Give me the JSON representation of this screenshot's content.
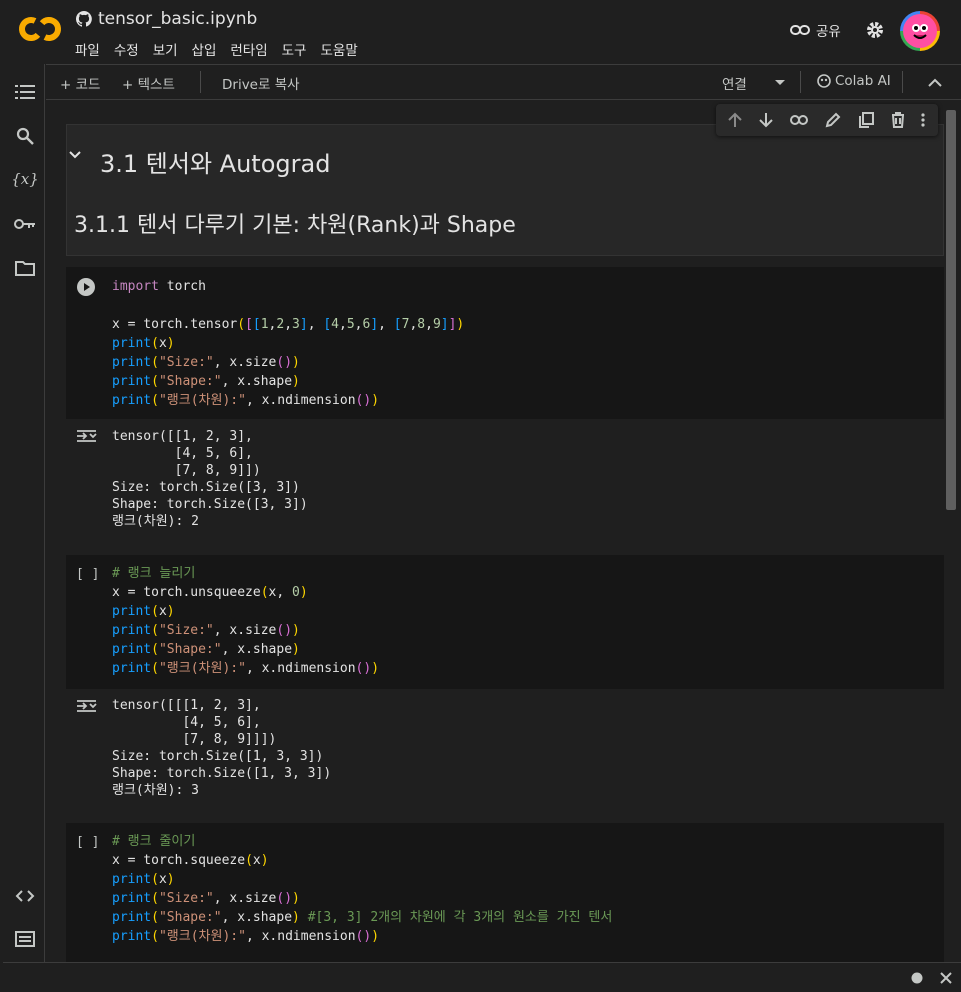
{
  "header": {
    "title": "tensor_basic.ipynb",
    "share_label": "공유",
    "menu": [
      "파일",
      "수정",
      "보기",
      "삽입",
      "런타임",
      "도구",
      "도움말"
    ]
  },
  "toolbar": {
    "add_code": "+ 코드",
    "add_text": "+ 텍스트",
    "copy_drive": "Drive로 복사",
    "connect": "연결",
    "colab_ai": "Colab AI"
  },
  "text_cell": {
    "h1": "3.1 텐서와 Autograd",
    "h2": "3.1.1 텐서 다루기 기본: 차원(Rank)과 Shape"
  },
  "cells": [
    {
      "bracket": "",
      "lines": [
        "import torch",
        "",
        "x = torch.tensor([[1,2,3], [4,5,6], [7,8,9]])",
        "print(x)",
        "print(\"Size:\", x.size())",
        "print(\"Shape:\", x.shape)",
        "print(\"랭크(차원):\", x.ndimension())"
      ],
      "output": [
        "tensor([[1, 2, 3],",
        "        [4, 5, 6],",
        "        [7, 8, 9]])",
        "Size: torch.Size([3, 3])",
        "Shape: torch.Size([3, 3])",
        "랭크(차원): 2"
      ]
    },
    {
      "bracket": "[ ]",
      "lines": [
        "# 랭크 늘리기",
        "x = torch.unsqueeze(x, 0)",
        "print(x)",
        "print(\"Size:\", x.size())",
        "print(\"Shape:\", x.shape)",
        "print(\"랭크(차원):\", x.ndimension())"
      ],
      "output": [
        "tensor([[[1, 2, 3],",
        "         [4, 5, 6],",
        "         [7, 8, 9]]])",
        "Size: torch.Size([1, 3, 3])",
        "Shape: torch.Size([1, 3, 3])",
        "랭크(차원): 3"
      ]
    },
    {
      "bracket": "[ ]",
      "lines": [
        "# 랭크 줄이기",
        "x = torch.squeeze(x)",
        "print(x)",
        "print(\"Size:\", x.size())",
        "print(\"Shape:\", x.shape) #[3, 3] 2개의 차원에 각 3개의 원소를 가진 텐서",
        "print(\"랭크(차원):\", x.ndimension())"
      ]
    }
  ],
  "colors": {
    "bg": "#1f1f1f",
    "code_bg": "#161616",
    "keyword": "#c586c0",
    "string": "#ce9178",
    "comment": "#6a9955"
  }
}
